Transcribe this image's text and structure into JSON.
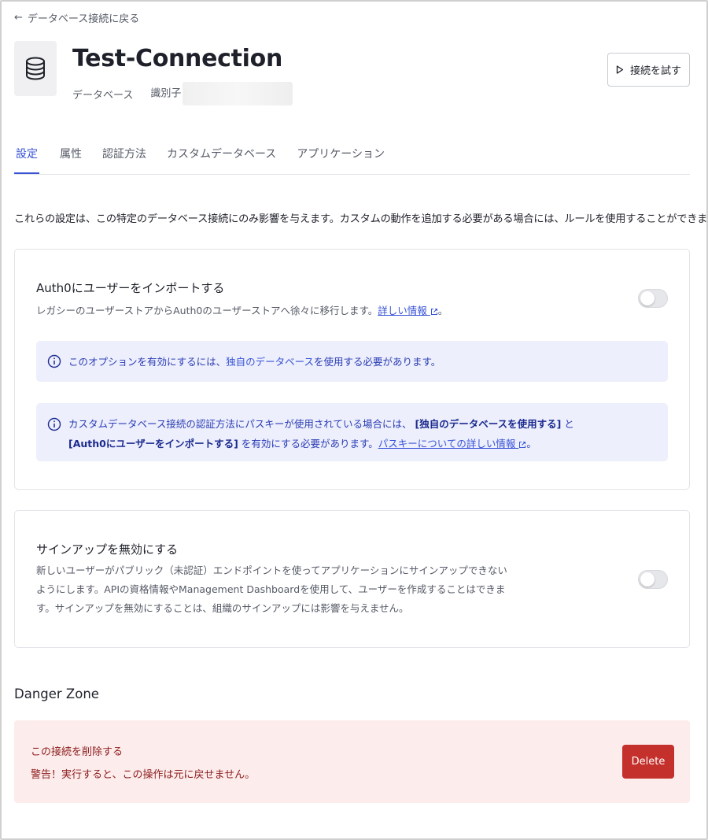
{
  "back_link": {
    "label": "データベース接続に戻る",
    "icon": "arrow-left-icon"
  },
  "header": {
    "icon": "database-icon",
    "title": "Test-Connection",
    "type_label": "データベース",
    "identifier_label": "識別子",
    "try_button": {
      "label": "接続を試す",
      "icon": "play-icon"
    }
  },
  "tabs": [
    {
      "label": "設定",
      "active": true
    },
    {
      "label": "属性",
      "active": false
    },
    {
      "label": "認証方法",
      "active": false
    },
    {
      "label": "カスタムデータベース",
      "active": false
    },
    {
      "label": "アプリケーション",
      "active": false
    }
  ],
  "description": "これらの設定は、この特定のデータベース接続にのみ影響を与えます。カスタムの動作を追加する必要がある場合には、ルールを使用することができます。",
  "import_card": {
    "title": "Auth0にユーザーをインポートする",
    "desc_prefix": "レガシーのユーザーストアからAuth0のユーザーストアへ徐々に移行します。",
    "link": "詳しい情報",
    "desc_suffix": "。",
    "toggle_on": false,
    "notice1": {
      "prefix": "このオプションを有効にするには、",
      "link": "独自のデータベース",
      "suffix": "を使用する必要があります。"
    },
    "notice2": {
      "line1_prefix": "カスタムデータベース接続の認証方法にパスキーが使用されている場合には、",
      "bold1": "[独自のデータベースを使用する]",
      "line1_suffix": "と",
      "bold2": "[Auth0にユーザーをインポートする]",
      "line2_mid": "を有効にする必要があります。",
      "link": "パスキーについての詳しい情報",
      "line2_suffix": "。"
    }
  },
  "signup_card": {
    "title": "サインアップを無効にする",
    "desc_lines": [
      "新しいユーザーがパブリック（未認証）エンドポイントを使ってアプリケーションにサインアップできない",
      "ようにします。APIの資格情報やManagement Dashboardを使用して、ユーザーを作成することはできま",
      "す。サインアップを無効にすることは、組織のサインアップには影響を与えません。"
    ],
    "toggle_on": false
  },
  "danger_zone": {
    "heading": "Danger Zone",
    "title": "この接続を削除する",
    "warning": "警告！実行すると、この操作は元に戻せません。",
    "delete_label": "Delete"
  },
  "colors": {
    "accent": "#3853d6",
    "danger_bg": "#fdecec",
    "danger_button": "#c4302b",
    "notice_bg": "#edeffc"
  }
}
